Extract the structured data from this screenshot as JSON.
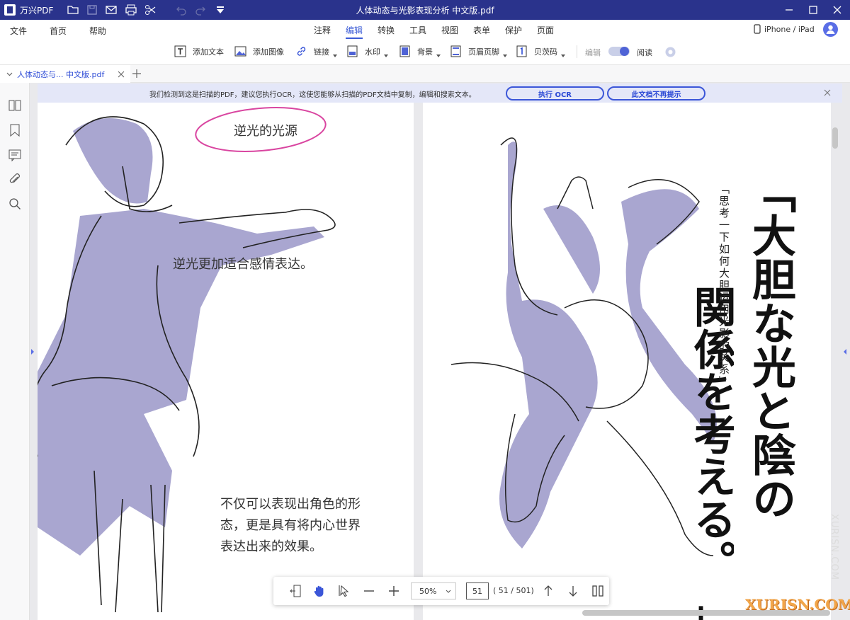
{
  "app": {
    "name": "万兴PDF",
    "window_title": "人体动态与光影表现分析  中文版.pdf"
  },
  "menu": {
    "left": [
      "文件",
      "首页",
      "帮助"
    ],
    "center": [
      "注释",
      "编辑",
      "转换",
      "工具",
      "视图",
      "表单",
      "保护",
      "页面"
    ],
    "active": "编辑",
    "device": "iPhone / iPad"
  },
  "toolbar": {
    "add_text": "添加文本",
    "add_image": "添加图像",
    "link": "链接",
    "watermark": "水印",
    "background": "背景",
    "header_footer": "页眉页脚",
    "bates": "贝茨码",
    "edit": "编辑",
    "read": "阅读"
  },
  "tab": {
    "label": "人体动态与...  中文版.pdf"
  },
  "ocr": {
    "message": "我们检测到这是扫描的PDF，建议您执行OCR，这使您能够从扫描的PDF文档中复制，编辑和搜索文本。",
    "run_ocr": "执行 OCR",
    "dont_remind": "此文档不再提示"
  },
  "page_left": {
    "bubble": "逆光的光源",
    "caption1": "逆光更加适合感情表达。",
    "caption2_lines": [
      "不仅可以表现出角色的形",
      "态，更是具有将内心世界",
      "表达出来的效果。"
    ]
  },
  "page_right": {
    "title_col1": "「大胆な光と陰の",
    "title_col2": "関係を考える。",
    "subtitle": "「思考一下如何大胆运用光影的关系」",
    "close_bracket": "」"
  },
  "zoom": {
    "level": "50%",
    "current_page": "51",
    "total": "( 51 / 501)"
  },
  "watermark": {
    "text": "XURISN.COM",
    "vertical": "XURISN.COM"
  },
  "colors": {
    "titlebar": "#2a338c",
    "accent": "#3b5bd6",
    "shadow": "#a9a6d0"
  }
}
